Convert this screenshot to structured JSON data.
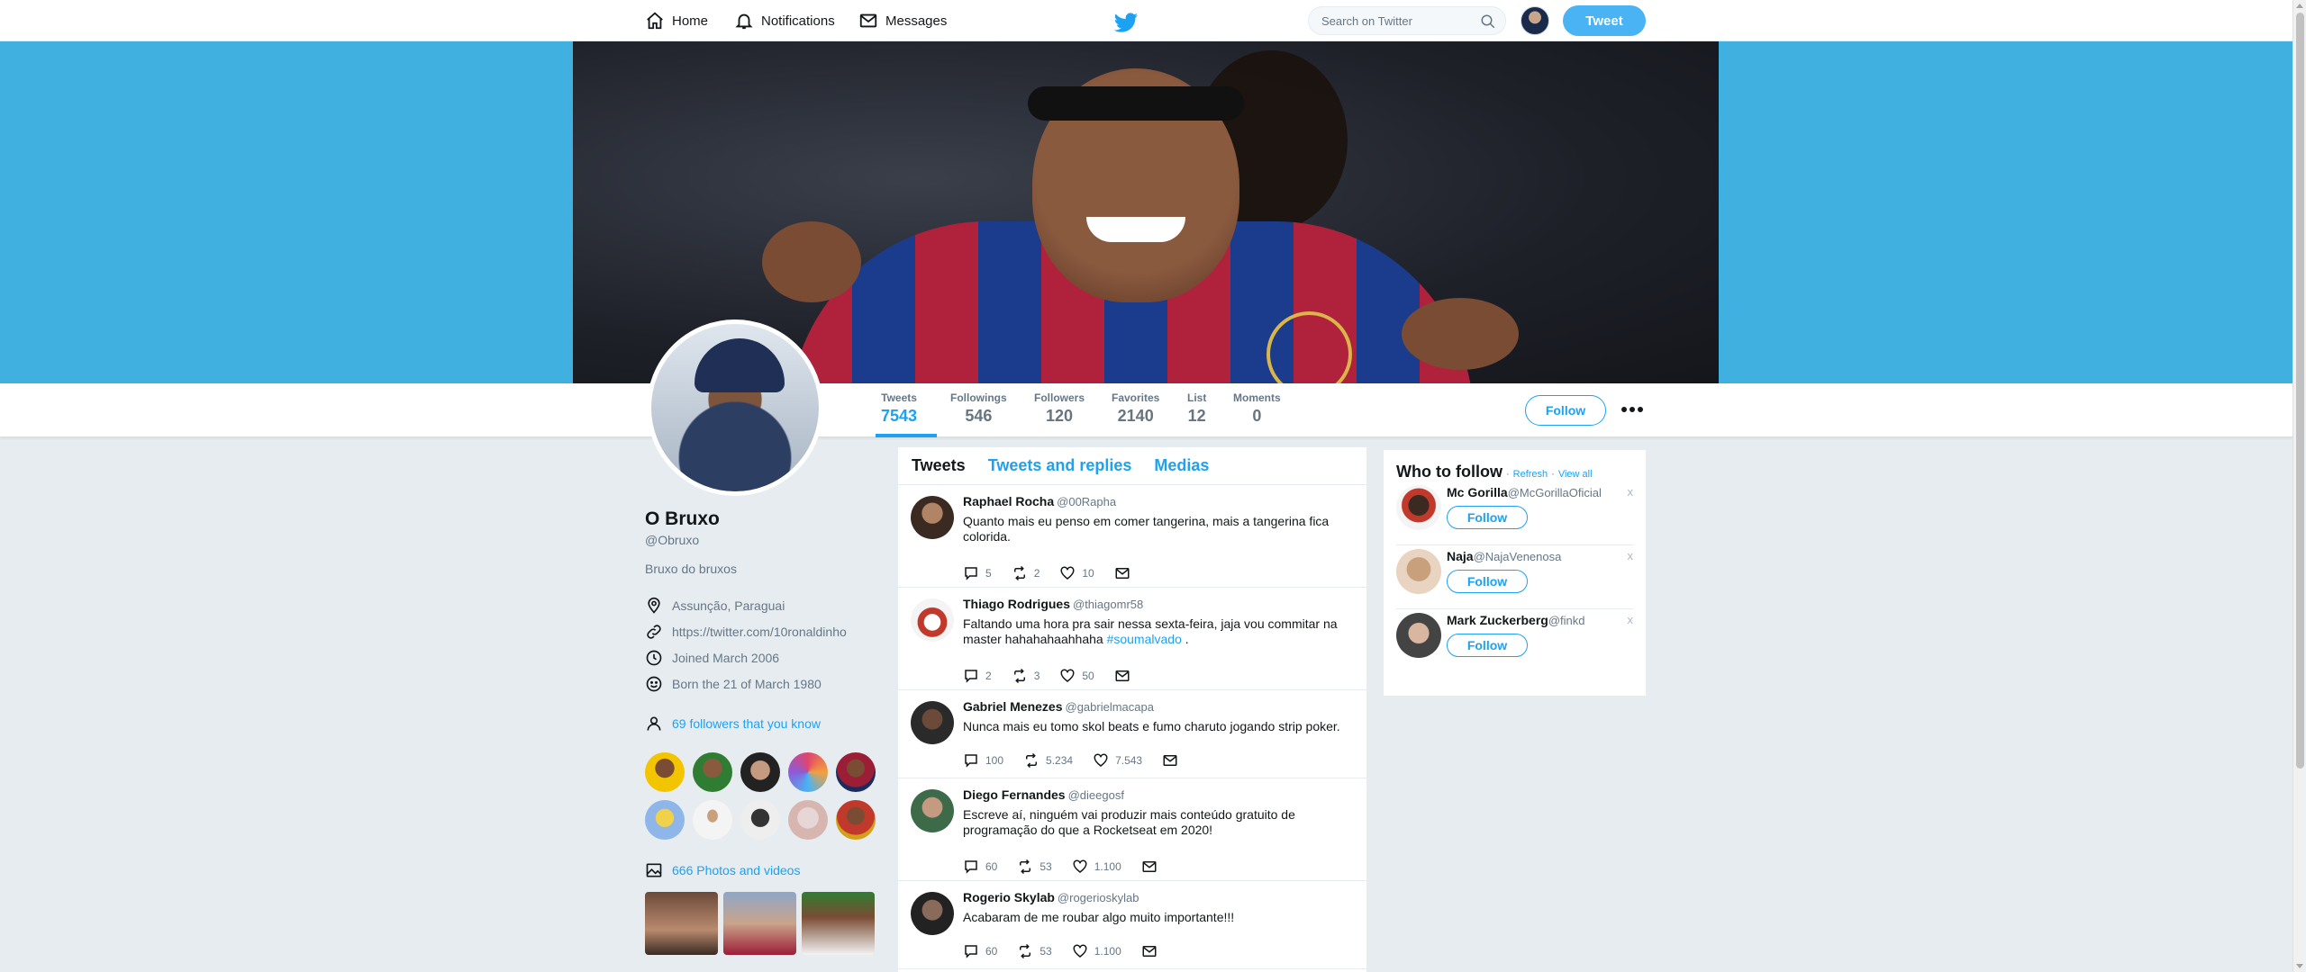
{
  "nav": {
    "home": "Home",
    "notifications": "Notifications",
    "messages": "Messages",
    "search_placeholder": "Search on Twitter",
    "tweet_button": "Tweet"
  },
  "profile": {
    "name": "O Bruxo",
    "handle": "@Obruxo",
    "bio": "Bruxo do bruxos",
    "location": "Assunção, Paraguai",
    "website": "https://twitter.com/10ronaldinho",
    "joined": "Joined March 2006",
    "born": "Born the 21 of March 1980",
    "followers_you_know": "69 followers that you know",
    "photos_videos": "666 Photos and videos",
    "follow_button": "Follow"
  },
  "stats": [
    {
      "label": "Tweets",
      "value": "7543"
    },
    {
      "label": "Followings",
      "value": "546"
    },
    {
      "label": "Followers",
      "value": "120"
    },
    {
      "label": "Favorites",
      "value": "2140"
    },
    {
      "label": "List",
      "value": "12"
    },
    {
      "label": "Moments",
      "value": "0"
    }
  ],
  "timeline": {
    "tabs": [
      "Tweets",
      "Tweets and replies",
      "Medias"
    ],
    "tweets": [
      {
        "name": "Raphael Rocha",
        "handle": "@00Rapha",
        "text": "Quanto mais eu penso em comer tangerina, mais a tangerina fica colorida.",
        "replies": "5",
        "retweets": "2",
        "likes": "10"
      },
      {
        "name": "Thiago Rodrigues",
        "handle": "@thiagomr58",
        "text": "Faltando uma hora pra sair nessa sexta-feira, jaja vou commitar na master hahahahaahhaha",
        "tag": "#soumalvado",
        "tail": " .",
        "replies": "2",
        "retweets": "3",
        "likes": "50"
      },
      {
        "name": "Gabriel Menezes",
        "handle": "@gabrielmacapa",
        "text": "Nunca mais eu tomo skol beats e fumo charuto jogando strip poker.",
        "replies": "100",
        "retweets": "5.234",
        "likes": "7.543"
      },
      {
        "name": "Diego Fernandes",
        "handle": "@dieegosf",
        "text": "Escreve aí, ninguém vai produzir mais conteúdo gratuito de programação do que a Rocketseat em 2020!",
        "replies": "60",
        "retweets": "53",
        "likes": "1.100"
      },
      {
        "name": "Rogerio Skylab",
        "handle": "@rogerioskylab",
        "text": "Acabaram de me roubar algo muito importante!!!",
        "replies": "60",
        "retweets": "53",
        "likes": "1.100"
      }
    ]
  },
  "who_to_follow": {
    "title": "Who to follow",
    "sep1": "·",
    "refresh": "Refresh",
    "sep2": "·",
    "view_all": "View all",
    "follow_label": "Follow",
    "close": "x",
    "users": [
      {
        "name": "Mc Gorilla",
        "handle": "@McGorillaOficial"
      },
      {
        "name": "Naja",
        "handle": "@NajaVenenosa"
      },
      {
        "name": "Mark Zuckerberg",
        "handle": "@finkd"
      }
    ]
  },
  "colors": {
    "accent": "#1da1f2",
    "banner": "#3fb0e0",
    "background": "#e6ecf0"
  }
}
